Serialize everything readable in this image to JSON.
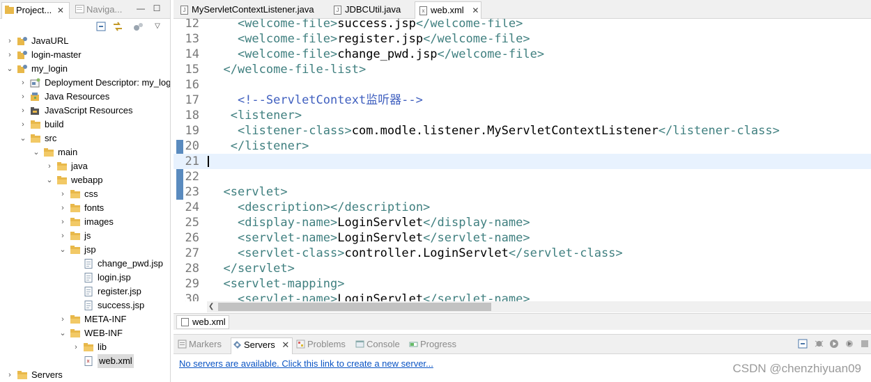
{
  "left_panel": {
    "tabs": [
      {
        "label": "Project...",
        "close": "✕"
      },
      {
        "label": "Naviga..."
      }
    ],
    "window_buttons": [
      "—",
      "☐"
    ],
    "tree": [
      {
        "label": "JavaURL",
        "level": 0,
        "arrow": "›",
        "icon": "project"
      },
      {
        "label": "login-master",
        "level": 0,
        "arrow": "›",
        "icon": "project"
      },
      {
        "label": "my_login",
        "level": 0,
        "arrow": "⌄",
        "icon": "project"
      },
      {
        "label": "Deployment Descriptor: my_log",
        "level": 1,
        "arrow": "›",
        "icon": "descriptor"
      },
      {
        "label": "Java Resources",
        "level": 1,
        "arrow": "›",
        "icon": "java-resources"
      },
      {
        "label": "JavaScript Resources",
        "level": 1,
        "arrow": "›",
        "icon": "js-resources"
      },
      {
        "label": "build",
        "level": 1,
        "arrow": "›",
        "icon": "folder"
      },
      {
        "label": "src",
        "level": 1,
        "arrow": "⌄",
        "icon": "folder"
      },
      {
        "label": "main",
        "level": 2,
        "arrow": "⌄",
        "icon": "folder"
      },
      {
        "label": "java",
        "level": 3,
        "arrow": "›",
        "icon": "folder"
      },
      {
        "label": "webapp",
        "level": 3,
        "arrow": "⌄",
        "icon": "folder"
      },
      {
        "label": "css",
        "level": 4,
        "arrow": "›",
        "icon": "folder"
      },
      {
        "label": "fonts",
        "level": 4,
        "arrow": "›",
        "icon": "folder"
      },
      {
        "label": "images",
        "level": 4,
        "arrow": "›",
        "icon": "folder"
      },
      {
        "label": "js",
        "level": 4,
        "arrow": "›",
        "icon": "folder"
      },
      {
        "label": "jsp",
        "level": 4,
        "arrow": "⌄",
        "icon": "folder"
      },
      {
        "label": "change_pwd.jsp",
        "level": 5,
        "arrow": "",
        "icon": "file"
      },
      {
        "label": "login.jsp",
        "level": 5,
        "arrow": "",
        "icon": "file"
      },
      {
        "label": "register.jsp",
        "level": 5,
        "arrow": "",
        "icon": "file"
      },
      {
        "label": "success.jsp",
        "level": 5,
        "arrow": "",
        "icon": "file"
      },
      {
        "label": "META-INF",
        "level": 4,
        "arrow": "›",
        "icon": "folder"
      },
      {
        "label": "WEB-INF",
        "level": 4,
        "arrow": "⌄",
        "icon": "folder"
      },
      {
        "label": "lib",
        "level": 5,
        "arrow": "›",
        "icon": "folder"
      },
      {
        "label": "web.xml",
        "level": 5,
        "arrow": "",
        "icon": "xml-file",
        "selected": true
      },
      {
        "label": "Servers",
        "level": 0,
        "arrow": "›",
        "icon": "folder"
      }
    ]
  },
  "editor": {
    "tabs": [
      {
        "label": "MyServletContextListener.java",
        "icon": "J"
      },
      {
        "label": "JDBCUtil.java",
        "icon": "J"
      },
      {
        "label": "web.xml",
        "icon": "x",
        "active": true,
        "close": "✕"
      }
    ],
    "current_line": 21,
    "lines": [
      {
        "n": "12",
        "parts": [
          {
            "t": "    ",
            "c": "txt"
          },
          {
            "t": "<welcome-file>",
            "c": "tag"
          },
          {
            "t": "success.jsp",
            "c": "txt"
          },
          {
            "t": "</welcome-file>",
            "c": "tag"
          }
        ]
      },
      {
        "n": "13",
        "parts": [
          {
            "t": "    ",
            "c": "txt"
          },
          {
            "t": "<welcome-file>",
            "c": "tag"
          },
          {
            "t": "register.jsp",
            "c": "txt"
          },
          {
            "t": "</welcome-file>",
            "c": "tag"
          }
        ]
      },
      {
        "n": "14",
        "parts": [
          {
            "t": "    ",
            "c": "txt"
          },
          {
            "t": "<welcome-file>",
            "c": "tag"
          },
          {
            "t": "change_pwd.jsp",
            "c": "txt"
          },
          {
            "t": "</welcome-file>",
            "c": "tag"
          }
        ]
      },
      {
        "n": "15",
        "parts": [
          {
            "t": "  ",
            "c": "txt"
          },
          {
            "t": "</welcome-file-list>",
            "c": "tag"
          }
        ]
      },
      {
        "n": "16",
        "parts": []
      },
      {
        "n": "17",
        "parts": [
          {
            "t": "    ",
            "c": "txt"
          },
          {
            "t": "<!--ServletContext监听器-->",
            "c": "cmt"
          }
        ]
      },
      {
        "n": "18",
        "parts": [
          {
            "t": "   ",
            "c": "txt"
          },
          {
            "t": "<listener>",
            "c": "tag"
          }
        ]
      },
      {
        "n": "19",
        "parts": [
          {
            "t": "    ",
            "c": "txt"
          },
          {
            "t": "<listener-class>",
            "c": "tag"
          },
          {
            "t": "com.modle.listener.MyServletContextListener",
            "c": "txt"
          },
          {
            "t": "</listener-class>",
            "c": "tag"
          }
        ]
      },
      {
        "n": "20",
        "parts": [
          {
            "t": "   ",
            "c": "txt"
          },
          {
            "t": "</listener>",
            "c": "tag"
          }
        ]
      },
      {
        "n": "21",
        "parts": []
      },
      {
        "n": "22",
        "parts": []
      },
      {
        "n": "23",
        "parts": [
          {
            "t": "  ",
            "c": "txt"
          },
          {
            "t": "<servlet>",
            "c": "tag"
          }
        ]
      },
      {
        "n": "24",
        "parts": [
          {
            "t": "    ",
            "c": "txt"
          },
          {
            "t": "<description></description>",
            "c": "tag"
          }
        ]
      },
      {
        "n": "25",
        "parts": [
          {
            "t": "    ",
            "c": "txt"
          },
          {
            "t": "<display-name>",
            "c": "tag"
          },
          {
            "t": "LoginServlet",
            "c": "txt"
          },
          {
            "t": "</display-name>",
            "c": "tag"
          }
        ]
      },
      {
        "n": "26",
        "parts": [
          {
            "t": "    ",
            "c": "txt"
          },
          {
            "t": "<servlet-name>",
            "c": "tag"
          },
          {
            "t": "LoginServlet",
            "c": "txt"
          },
          {
            "t": "</servlet-name>",
            "c": "tag"
          }
        ]
      },
      {
        "n": "27",
        "parts": [
          {
            "t": "    ",
            "c": "txt"
          },
          {
            "t": "<servlet-class>",
            "c": "tag"
          },
          {
            "t": "controller.LoginServlet",
            "c": "txt"
          },
          {
            "t": "</servlet-class>",
            "c": "tag"
          }
        ]
      },
      {
        "n": "28",
        "parts": [
          {
            "t": "  ",
            "c": "txt"
          },
          {
            "t": "</servlet>",
            "c": "tag"
          }
        ]
      },
      {
        "n": "29",
        "parts": [
          {
            "t": "  ",
            "c": "txt"
          },
          {
            "t": "<servlet-mapping>",
            "c": "tag"
          }
        ]
      },
      {
        "n": "30",
        "parts": [
          {
            "t": "    ",
            "c": "txt"
          },
          {
            "t": "<servlet-name>",
            "c": "tag"
          },
          {
            "t": "LoginServlet",
            "c": "txt"
          },
          {
            "t": "</servlet-name>",
            "c": "tag"
          }
        ]
      }
    ],
    "bottom_tab": "web.xml"
  },
  "bottom_panel": {
    "tabs": [
      {
        "label": "Markers",
        "icon": "markers-icon"
      },
      {
        "label": "Servers",
        "icon": "servers-icon",
        "active": true,
        "close": "✕"
      },
      {
        "label": "Problems",
        "icon": "problems-icon"
      },
      {
        "label": "Console",
        "icon": "console-icon"
      },
      {
        "label": "Progress",
        "icon": "progress-icon"
      }
    ],
    "message": "No servers are available. Click this link to create a new server..."
  },
  "watermark": "CSDN @chenzhiyuan09",
  "colors": {
    "tag": "#3f7f7f",
    "comment": "#3f5fbf",
    "current_line": "#e8f2fe",
    "link": "#0a54c4"
  }
}
